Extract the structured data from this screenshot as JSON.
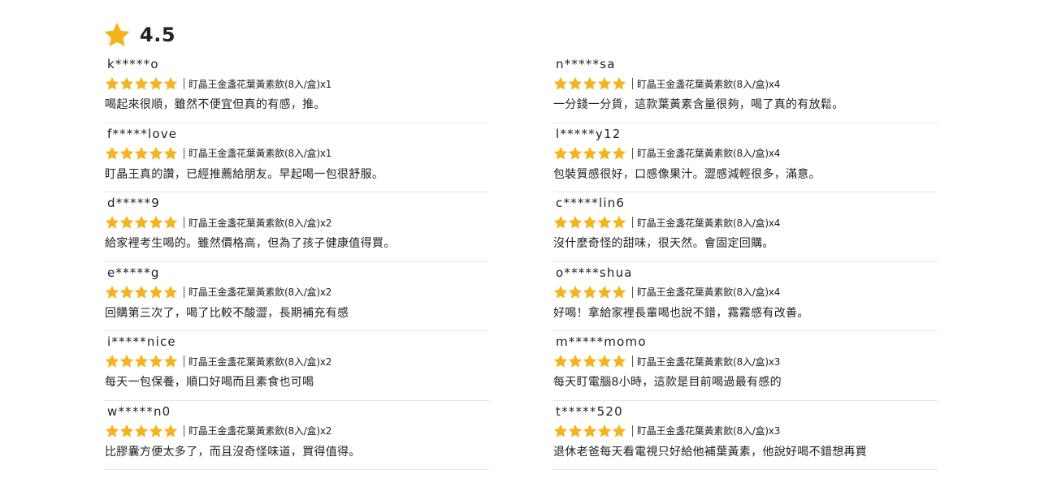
{
  "summary": {
    "rating": "4.5",
    "star_color": "#f5b31d"
  },
  "colors": {
    "star": "#f5b31d",
    "divider": "#e6e6e6",
    "text": "#222222"
  },
  "reviews_left": [
    {
      "reviewer": "k*****o",
      "stars": 5,
      "product": "盯晶王金盞花葉黃素飲(8入/盒)x1",
      "comment": "喝起來很順，雖然不便宜但真的有感，推。"
    },
    {
      "reviewer": "f*****love",
      "stars": 5,
      "product": "盯晶王金盞花葉黃素飲(8入/盒)x1",
      "comment": "盯晶王真的讚，已經推薦給朋友。早起喝一包很舒服。"
    },
    {
      "reviewer": "d*****9",
      "stars": 5,
      "product": "盯晶王金盞花葉黃素飲(8入/盒)x2",
      "comment": "給家裡考生喝的。雖然價格高，但為了孩子健康值得買。"
    },
    {
      "reviewer": "e*****g",
      "stars": 5,
      "product": "盯晶王金盞花葉黃素飲(8入/盒)x2",
      "comment": "回購第三次了，喝了比較不酸澀，長期補充有感"
    },
    {
      "reviewer": "i*****nice",
      "stars": 5,
      "product": "盯晶王金盞花葉黃素飲(8入/盒)x2",
      "comment": "每天一包保養，順口好喝而且素食也可喝"
    },
    {
      "reviewer": "w*****n0",
      "stars": 5,
      "product": "盯晶王金盞花葉黃素飲(8入/盒)x2",
      "comment": "比膠囊方便太多了，而且沒奇怪味道，買得值得。"
    }
  ],
  "reviews_right": [
    {
      "reviewer": "n*****sa",
      "stars": 5,
      "product": "盯晶王金盞花葉黃素飲(8入/盒)x4",
      "comment": "一分錢一分貨，這款葉黃素含量很夠，喝了真的有放鬆。"
    },
    {
      "reviewer": "l*****y12",
      "stars": 5,
      "product": "盯晶王金盞花葉黃素飲(8入/盒)x4",
      "comment": "包裝質感很好，口感像果汁。澀感減輕很多，滿意。"
    },
    {
      "reviewer": "c*****lin6",
      "stars": 5,
      "product": "盯晶王金盞花葉黃素飲(8入/盒)x4",
      "comment": "沒什麼奇怪的甜味，很天然。會固定回購。"
    },
    {
      "reviewer": "o*****shua",
      "stars": 5,
      "product": "盯晶王金盞花葉黃素飲(8入/盒)x4",
      "comment": "好喝！拿給家裡長輩喝也說不錯，霧霧感有改善。"
    },
    {
      "reviewer": "m*****momo",
      "stars": 5,
      "product": "盯晶王金盞花葉黃素飲(8入/盒)x3",
      "comment": "每天盯電腦8小時，這款是目前喝過最有感的"
    },
    {
      "reviewer": "t*****520",
      "stars": 5,
      "product": "盯晶王金盞花葉黃素飲(8入/盒)x3",
      "comment": "退休老爸每天看電視只好給他補葉黃素，他說好喝不錯想再買"
    }
  ]
}
